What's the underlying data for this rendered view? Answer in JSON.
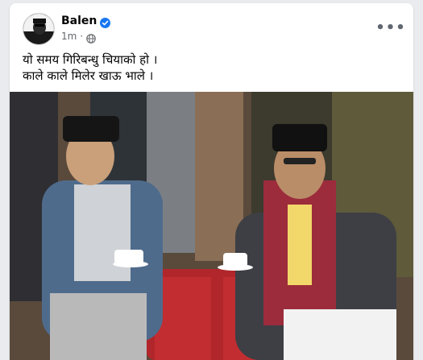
{
  "post": {
    "author": "Balen",
    "verified_icon": "verified-badge-icon",
    "timestamp": "1m",
    "separator": "·",
    "audience_icon": "globe-icon",
    "more_label": "•••",
    "text_lines": [
      "यो समय गिरिबन्धु चियाको हो ।",
      "काले काले मिलेर खाऊ भाले ।"
    ],
    "photo_icon": "post-photo"
  },
  "colors": {
    "accent": "#1877f2",
    "text_primary": "#050505",
    "text_secondary": "#65676b"
  }
}
